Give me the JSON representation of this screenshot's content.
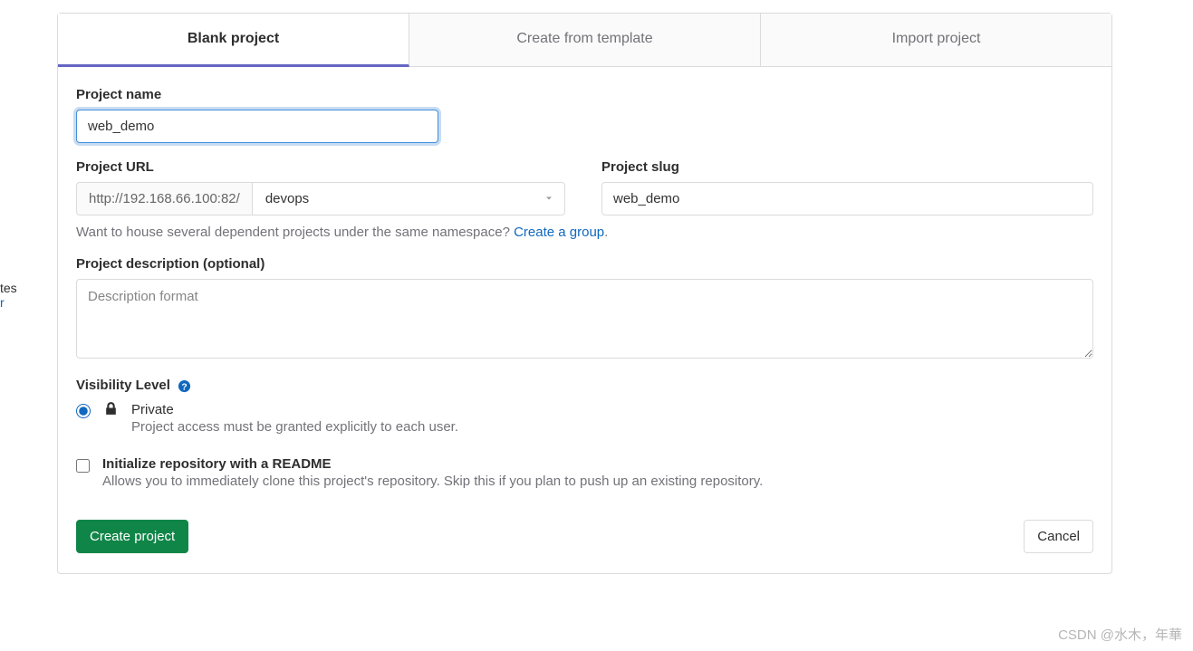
{
  "sidebar": {
    "fragment1": "tes",
    "fragment2": "r"
  },
  "tabs": [
    {
      "label": "Blank project",
      "active": true
    },
    {
      "label": "Create from template",
      "active": false
    },
    {
      "label": "Import project",
      "active": false
    }
  ],
  "form": {
    "project_name": {
      "label": "Project name",
      "value": "web_demo"
    },
    "project_url": {
      "label": "Project URL",
      "prefix": "http://192.168.66.100:82/",
      "namespace": "devops"
    },
    "project_slug": {
      "label": "Project slug",
      "value": "web_demo"
    },
    "namespace_hint": {
      "text": "Want to house several dependent projects under the same namespace? ",
      "link": "Create a group",
      "suffix": "."
    },
    "description": {
      "label": "Project description (optional)",
      "placeholder": "Description format",
      "value": ""
    },
    "visibility": {
      "label": "Visibility Level",
      "option_label": "Private",
      "option_desc": "Project access must be granted explicitly to each user.",
      "checked": true
    },
    "readme": {
      "label": "Initialize repository with a README",
      "desc": "Allows you to immediately clone this project's repository. Skip this if you plan to push up an existing repository.",
      "checked": false
    },
    "submit_label": "Create project",
    "cancel_label": "Cancel"
  },
  "watermark": "CSDN @水木，年華"
}
